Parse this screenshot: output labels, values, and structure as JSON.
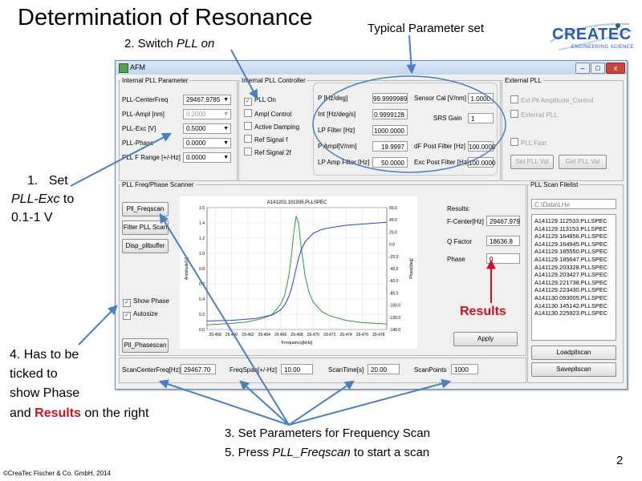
{
  "slide": {
    "title": "Determination of Resonance",
    "typical_caption": "Typical Parameter set",
    "step2_prefix": "2. Switch ",
    "step2_italic": "PLL on",
    "step1_num": "1.",
    "step1_set": "Set",
    "step1_italic": "PLL-Exc",
    "step1_to": " to",
    "step1_range": "0.1-1 V",
    "step4_line1": "4. Has to be",
    "step4_line2": "ticked to",
    "step4_line3": "show Phase",
    "step4_line4a": "and ",
    "step4_line4b": "Results",
    "step4_line4c": " on the right",
    "step3": "3. Set Parameters for Frequency Scan",
    "step5_prefix": "5. Press ",
    "step5_italic": "PLL_Freqscan",
    "step5_suffix": " to start a scan",
    "results_caption": "Results",
    "copyright": "©CreaTec Fischer & Co. GmbH, 2014",
    "page_number": "2",
    "accent_red": "#d0101f",
    "arrow_color": "#4a7fc0"
  },
  "logo": {
    "name": "CREATEC",
    "tagline": "ENGINEERING SCIENCE"
  },
  "window": {
    "title": "AFM",
    "controls": {
      "minimize": "–",
      "maximize": "□",
      "close": "x"
    },
    "internal_pll_parameter": {
      "title": "Internal PLL Parameter",
      "rows": [
        {
          "label": "PLL-CenterFreq",
          "value": "29467.9785",
          "disabled": false
        },
        {
          "label": "PLL-Ampl  [nm]",
          "value": "0.2000",
          "disabled": true
        },
        {
          "label": "PLL-Exc  [V]",
          "value": "0.5000",
          "disabled": false
        },
        {
          "label": "PLL-Phase",
          "value": "0.0000",
          "disabled": false
        },
        {
          "label": "PLL F Range [+/-Hz]",
          "value": "0.0000",
          "disabled": false
        }
      ]
    },
    "internal_pll_controller": {
      "title": "Internal PLL Controller",
      "checks": [
        {
          "label": "PLL On",
          "checked": true
        },
        {
          "label": "Ampl Control",
          "checked": false
        },
        {
          "label": "Active Damping",
          "checked": false
        },
        {
          "label": "Ref Signal f",
          "checked": false
        },
        {
          "label": "Ref Signal 2f",
          "checked": false
        }
      ],
      "fields_left": [
        {
          "label": "P [Hz/deg]",
          "value": "99.9999989"
        },
        {
          "label": "Int [Hz/deg/s]",
          "value": "0.9999128"
        },
        {
          "label": "LP Filter [Hz]",
          "value": "1000.0000"
        },
        {
          "label": "P Ampl[V/nm]",
          "value": "19.9997"
        },
        {
          "label": "LP Amp Filter [Hz]",
          "value": "50.0000"
        }
      ],
      "sensor_cal": {
        "label": "Sensor Cal [V/nm]",
        "value": "1.0000"
      },
      "srs_gain": {
        "label": "SRS  Gain",
        "value": "1"
      },
      "df_post": {
        "label": "dF Post Filter [Hz]",
        "value": "100.0000"
      },
      "exc_post": {
        "label": "Exc Post Filter [Hz]",
        "value": "100.0000"
      }
    },
    "external_pll": {
      "title": "External PLL",
      "checks": [
        "Ext Pll Amplitude_Control",
        "External PLL",
        "PLL Fast"
      ],
      "set_button": "Set PLL Val",
      "get_button": "Get PLL Val"
    },
    "scanner": {
      "title": "PLL Freq/Phase Scanner",
      "buttons": [
        "Pll_Freqscan",
        "Filter PLL Scan",
        "Disp_pllbuffer"
      ],
      "show_phase": "Show Phase",
      "autosize": "Autosize",
      "phasescan_button": "Pll_Phasescan"
    },
    "results": {
      "title": "Results:",
      "f_center_label": "F-Center[Hz]",
      "f_center_value": "29467.979",
      "q_label": "Q Factor",
      "q_value": "18636.8",
      "phase_label": "Phase",
      "phase_value": "0",
      "apply_button": "Apply"
    },
    "filelist": {
      "title": "PLL Scan Filelist",
      "path": "C:\\Data\\LHe",
      "files": [
        "A141129.112533.PLLSPEC",
        "A141129.113153.PLLSPEC",
        "A141129.164856.PLLSPEC",
        "A141129.164945.PLLSPEC",
        "A141129.185550.PLLSPEC",
        "A141129.185647.PLLSPEC",
        "A141129.203328.PLLSPEC",
        "A141129.203427.PLLSPEC",
        "A141129.221738.PLLSPEC",
        "A141129.223430.PLLSPEC",
        "A141130.093005.PLLSPEC",
        "A141130.145142.PLLSPEC",
        "A141130.225923.PLLSPEC"
      ],
      "load_button": "Loadpllscan",
      "save_button": "Savepllscan"
    },
    "scan_params": [
      {
        "label": "ScanCenterFreq[Hz]",
        "value": "29467.70"
      },
      {
        "label": "FreqSpan[+/-Hz]",
        "value": "10.00"
      },
      {
        "label": "ScanTime[s]",
        "value": "20.00"
      },
      {
        "label": "ScanPoints",
        "value": "1000"
      }
    ]
  },
  "chart_data": {
    "type": "line",
    "title": "A141202.101935.PLLSPEC",
    "xlabel": "Frequency[kHz]",
    "ylabel": "Amplitude[V]",
    "y2label": "Phase[deg]",
    "xlim": [
      29.457,
      29.479
    ],
    "ylim": [
      0,
      1.6
    ],
    "y2lim": [
      -140,
      60
    ],
    "x_ticks": [
      "29.458",
      "29.460",
      "29.462",
      "29.464",
      "29.466",
      "29.468",
      "29.470",
      "29.472",
      "29.474",
      "29.476",
      "29.478"
    ],
    "y_ticks": [
      "0.0",
      "0.2",
      "0.4",
      "0.6",
      "0.8",
      "1.0",
      "1.2",
      "1.4",
      "1.6"
    ],
    "y2_ticks": [
      "-140.0",
      "-120.0",
      "-100.0",
      "-80.0",
      "-60.0",
      "-40.0",
      "-20.0",
      "0.0",
      "20.0",
      "40.0",
      "60.0"
    ],
    "grid": true,
    "series": [
      {
        "role": "amplitude",
        "color": "#2e9a3e",
        "x": [
          29.457,
          29.46,
          29.462,
          29.464,
          29.465,
          29.466,
          29.4665,
          29.467,
          29.4673,
          29.4676,
          29.4679,
          29.4682,
          29.4685,
          29.469,
          29.4695,
          29.47,
          29.471,
          29.472,
          29.474,
          29.476,
          29.479
        ],
        "y": [
          0.06,
          0.08,
          0.1,
          0.15,
          0.2,
          0.33,
          0.45,
          0.7,
          0.95,
          1.25,
          1.49,
          1.4,
          1.1,
          0.7,
          0.48,
          0.36,
          0.24,
          0.18,
          0.12,
          0.09,
          0.07
        ]
      },
      {
        "role": "phase",
        "color": "#2a3fd6",
        "x": [
          29.457,
          29.46,
          29.463,
          29.465,
          29.466,
          29.4665,
          29.467,
          29.4673,
          29.4676,
          29.4679,
          29.4682,
          29.4685,
          29.469,
          29.47,
          29.471,
          29.472,
          29.474,
          29.476,
          29.479
        ],
        "y": [
          -126,
          -125,
          -122,
          -116,
          -108,
          -100,
          -86,
          -74,
          -58,
          -40,
          -24,
          -10,
          4,
          18,
          24,
          27,
          31,
          33,
          36
        ]
      }
    ]
  }
}
